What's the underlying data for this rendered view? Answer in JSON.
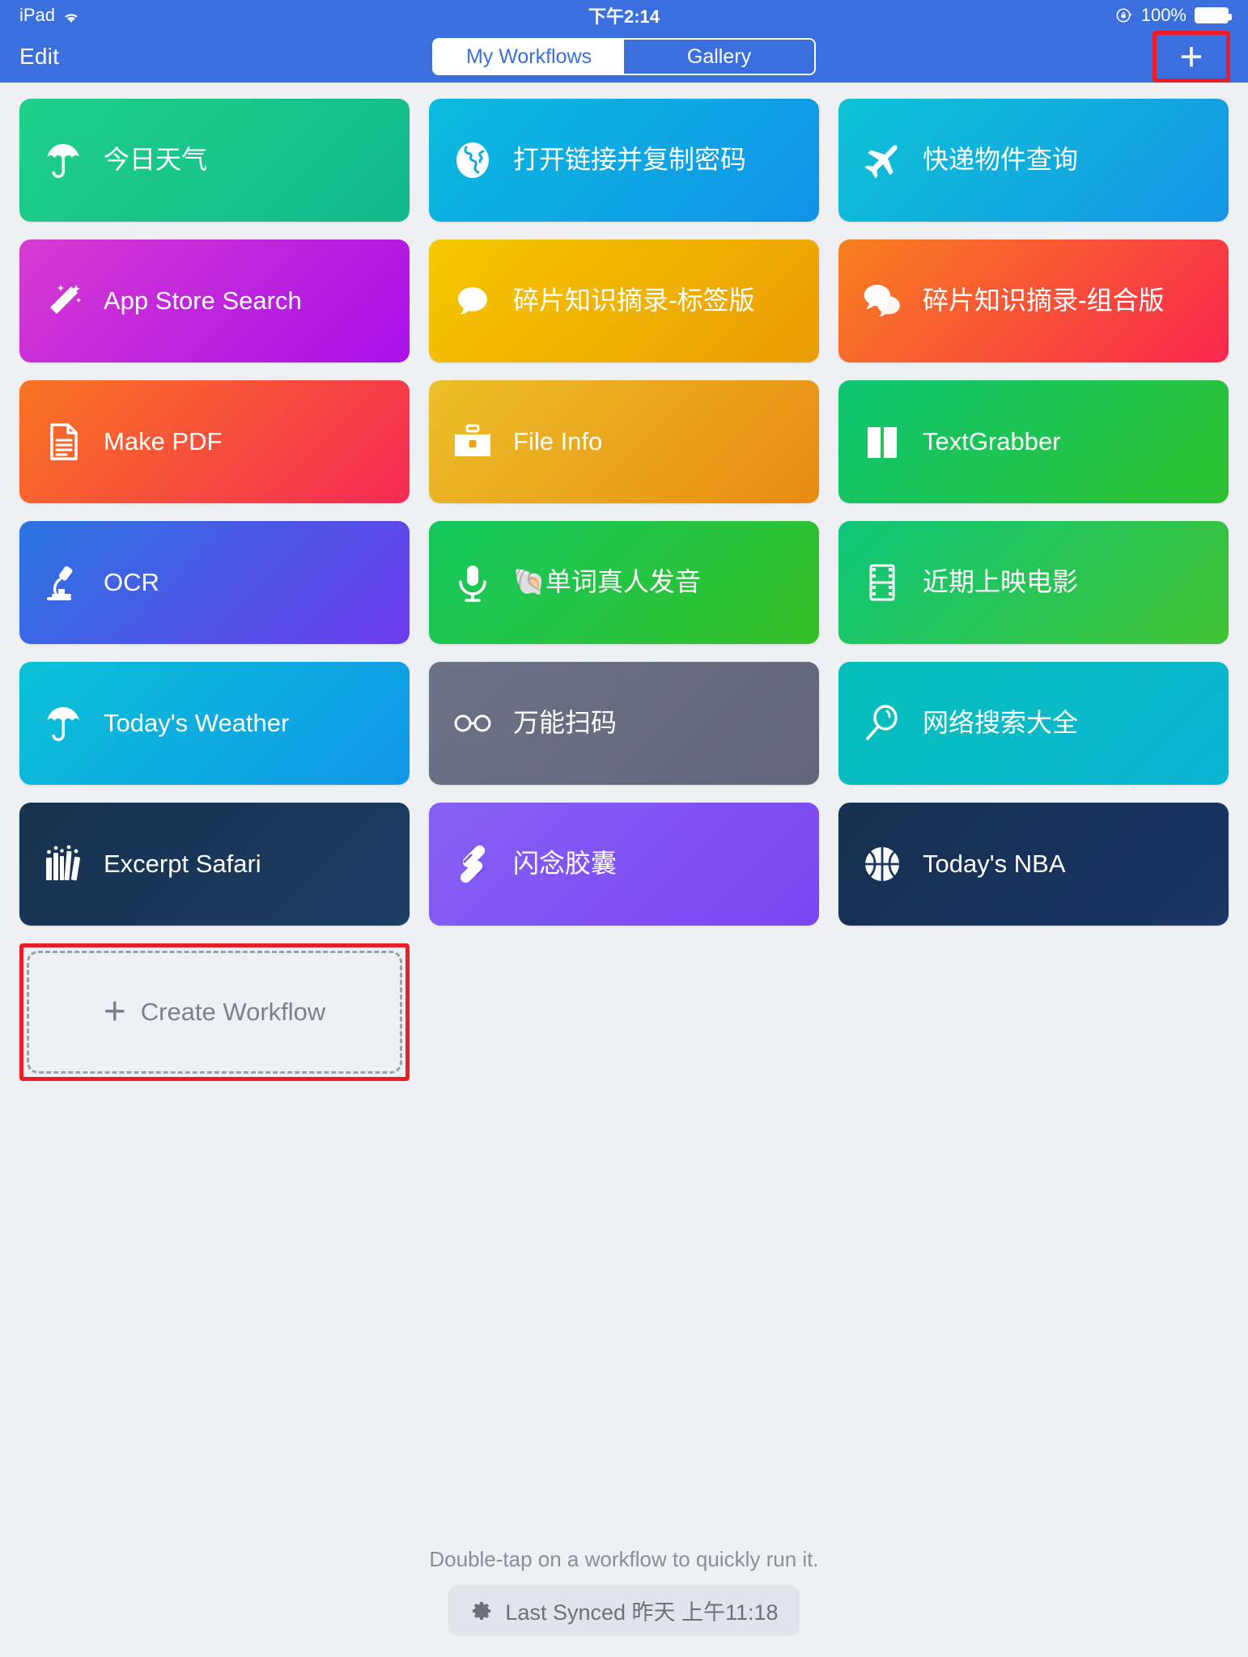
{
  "status_bar": {
    "device": "iPad",
    "wifi_icon": "wifi-icon",
    "time": "下午2:14",
    "orientation_lock_icon": "rotation-lock-icon",
    "battery_percent": "100%",
    "battery_icon": "battery-full-icon"
  },
  "nav": {
    "edit_label": "Edit",
    "tabs": [
      {
        "label": "My Workflows",
        "active": true
      },
      {
        "label": "Gallery",
        "active": false
      }
    ],
    "add_button_glyph": "+",
    "add_button_name": "add-workflow-button",
    "highlight_color": "#ed1c24"
  },
  "grid": {
    "tiles": [
      {
        "label": "今日天气",
        "icon": "umbrella-icon",
        "color_from": "#1fd08a",
        "color_to": "#14b98b",
        "lang": "cn"
      },
      {
        "label": "打开链接并复制密码",
        "icon": "globe-icon",
        "color_from": "#0bbbdd",
        "color_to": "#1193e8",
        "lang": "cn"
      },
      {
        "label": "快递物件查询",
        "icon": "airplane-icon",
        "color_from": "#0ec3d4",
        "color_to": "#1596e6",
        "lang": "cn"
      },
      {
        "label": "App Store Search",
        "icon": "magic-wand-icon",
        "color_from": "#d63bd0",
        "color_to": "#a710e8",
        "lang": "en"
      },
      {
        "label": "碎片知识摘录-标签版",
        "icon": "speech-bubble-icon",
        "color_from": "#f5c800",
        "color_to": "#eb9c06",
        "lang": "cn"
      },
      {
        "label": "碎片知识摘录-组合版",
        "icon": "two-speech-bubbles-icon",
        "color_from": "#f8801f",
        "color_to": "#f8274f",
        "lang": "cn"
      },
      {
        "label": "Make PDF",
        "icon": "document-icon",
        "color_from": "#f87521",
        "color_to": "#f52a57",
        "lang": "en"
      },
      {
        "label": "File Info",
        "icon": "briefcase-icon",
        "color_from": "#ecc02a",
        "color_to": "#e88a12",
        "lang": "en"
      },
      {
        "label": "TextGrabber",
        "icon": "open-book-icon",
        "color_from": "#0ec572",
        "color_to": "#2fc22f",
        "lang": "en"
      },
      {
        "label": "OCR",
        "icon": "microscope-icon",
        "color_from": "#2a74e0",
        "color_to": "#6d3ced",
        "lang": "en"
      },
      {
        "label": "🐚单词真人发音",
        "icon": "microphone-icon",
        "color_from": "#14c85f",
        "color_to": "#36bf27",
        "lang": "cn"
      },
      {
        "label": "近期上映电影",
        "icon": "film-strip-icon",
        "color_from": "#0fc779",
        "color_to": "#41c234",
        "lang": "cn"
      },
      {
        "label": "Today's Weather",
        "icon": "umbrella-icon",
        "color_from": "#0bc2d6",
        "color_to": "#1196e8",
        "lang": "en"
      },
      {
        "label": "万能扫码",
        "icon": "glasses-icon",
        "color_from": "#6d7386",
        "color_to": "#606678",
        "lang": "cn"
      },
      {
        "label": "网络搜索大全",
        "icon": "magnifier-icon",
        "color_from": "#05bfb9",
        "color_to": "#0cb4d4",
        "lang": "cn"
      },
      {
        "label": "Excerpt Safari",
        "icon": "books-icon",
        "color_from": "#17314f",
        "color_to": "#1b3d63",
        "lang": "en"
      },
      {
        "label": "闪念胶囊",
        "icon": "capsules-icon",
        "color_from": "#8661f5",
        "color_to": "#7a45f2",
        "lang": "cn"
      },
      {
        "label": "Today's NBA",
        "icon": "basketball-icon",
        "color_from": "#15304f",
        "color_to": "#1b3566",
        "lang": "en"
      }
    ],
    "create_workflow": {
      "label": "Create Workflow",
      "plus_glyph": "+",
      "highlight_color": "#ed1c24"
    }
  },
  "footer": {
    "hint": "Double-tap on a workflow to quickly run it.",
    "sync_icon": "gear-icon",
    "sync_label": "Last Synced 昨天 上午11:18"
  }
}
